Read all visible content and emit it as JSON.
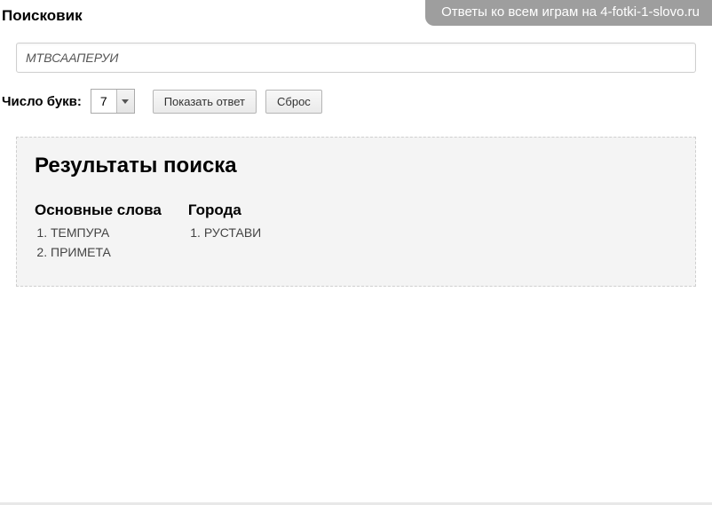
{
  "banner": "Ответы ко всем играм на 4-fotki-1-slovo.ru",
  "page_title": "Поисковик",
  "letters_value": "МТВСААПЕРУИ",
  "controls": {
    "label": "Число букв:",
    "selected": "7",
    "show_answer": "Показать ответ",
    "reset": "Сброс"
  },
  "results": {
    "title": "Результаты поиска",
    "columns": [
      {
        "heading": "Основные слова",
        "items": [
          "ТЕМПУРА",
          "ПРИМЕТА"
        ]
      },
      {
        "heading": "Города",
        "items": [
          "РУСТАВИ"
        ]
      }
    ]
  }
}
